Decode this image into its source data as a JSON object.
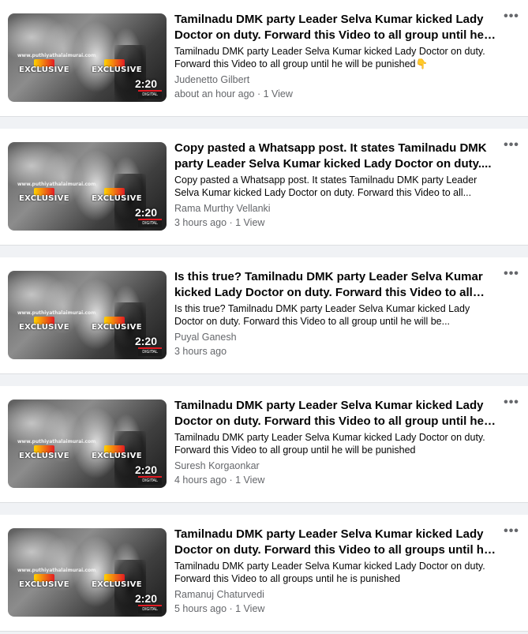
{
  "posts": [
    {
      "title": "Tamilnadu DMK party Leader Selva Kumar kicked Lady Doctor on duty. Forward this Video to all group until he w...",
      "description": "Tamilnadu DMK party Leader Selva Kumar kicked Lady Doctor on duty. Forward this Video to all group until he will be punished👇",
      "author": "Judenetto Gilbert",
      "meta": "about an hour ago · 1 View",
      "duration": "2:20"
    },
    {
      "title": "Copy pasted a Whatsapp post. It states Tamilnadu DMK party Leader Selva Kumar kicked Lady Doctor on duty....",
      "description": "Copy pasted a Whatsapp post. It states Tamilnadu DMK party Leader Selva Kumar kicked Lady Doctor on duty. Forward this Video to all...",
      "author": "Rama Murthy Vellanki",
      "meta": "3 hours ago · 1 View",
      "duration": "2:20"
    },
    {
      "title": "Is this true? Tamilnadu DMK party Leader Selva Kumar kicked Lady Doctor on duty. Forward this Video to all grou...",
      "description": "Is this true? Tamilnadu DMK party Leader Selva Kumar kicked Lady Doctor on duty. Forward this Video to all group until he will be...",
      "author": "Puyal Ganesh",
      "meta": "3 hours ago",
      "duration": "2:20"
    },
    {
      "title": "Tamilnadu DMK party Leader Selva Kumar kicked Lady Doctor on duty. Forward this Video to all group until he w...",
      "description": "Tamilnadu DMK party Leader Selva Kumar kicked Lady Doctor on duty. Forward this Video to all group until he will be punished",
      "author": "Suresh Korgaonkar",
      "meta": "4 hours ago · 1 View",
      "duration": "2:20"
    },
    {
      "title": "Tamilnadu DMK party Leader Selva Kumar kicked Lady Doctor on duty. Forward this Video to all groups until he i...",
      "description": "Tamilnadu DMK party Leader Selva Kumar kicked Lady Doctor on duty. Forward this Video to all groups until he is punished",
      "author": "Ramanuj Chaturvedi",
      "meta": "5 hours ago · 1 View",
      "duration": "2:20"
    }
  ],
  "thumbnail": {
    "badge_text": "EXCLUSIVE",
    "site_text": "www.puthiyathalaimurai.com",
    "corner_logo_text": "DIGITAL",
    "icon": "video-thumbnail-icon"
  },
  "more_icon": "more-options-icon",
  "more_symbol": "•••",
  "colors": {
    "page_background": "#f0f2f5",
    "card_background": "#ffffff",
    "secondary_text": "#65676b",
    "primary_text": "#050505"
  }
}
